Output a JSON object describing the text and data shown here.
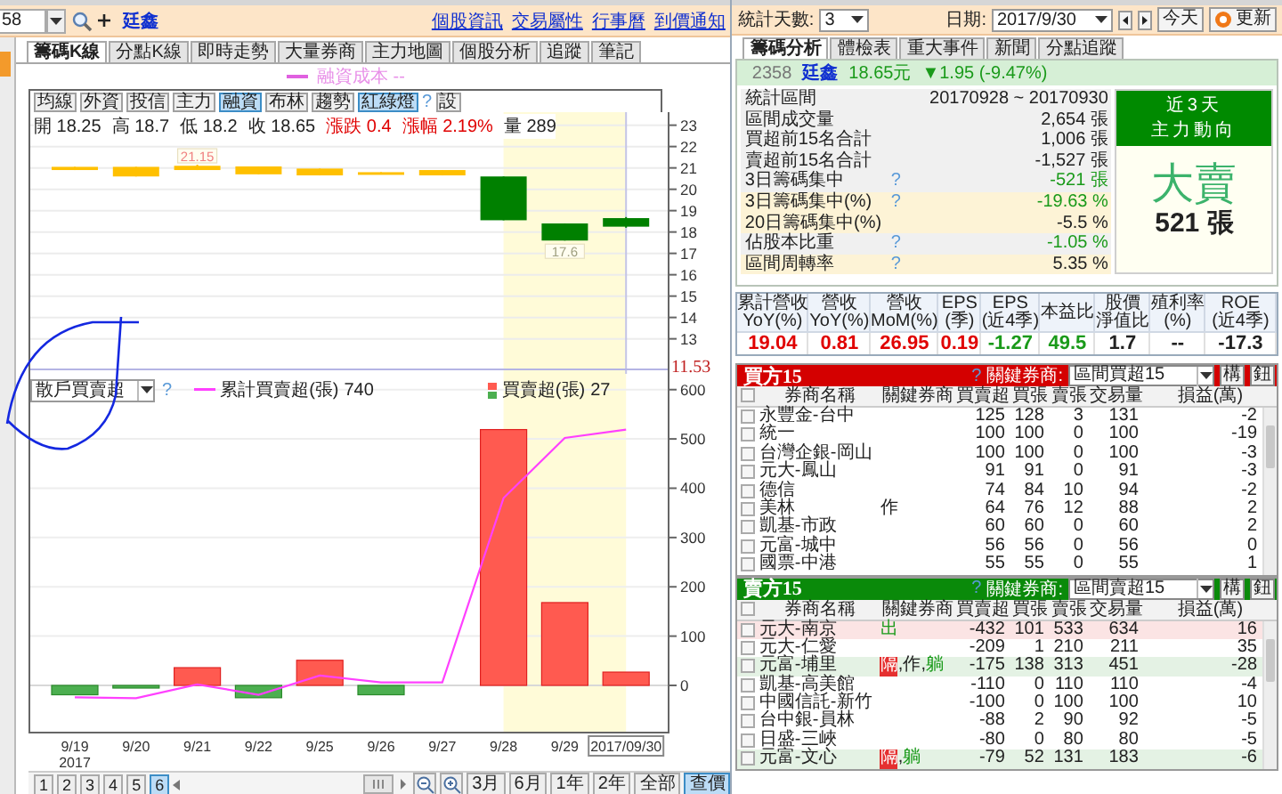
{
  "left": {
    "stock_field": {
      "value": "58"
    },
    "stock_name": "廷鑫",
    "links": [
      "個股資訊",
      "交易屬性",
      "行事曆",
      "到價通知"
    ],
    "tabs": [
      {
        "label": "籌碼K線",
        "selected": true
      },
      {
        "label": "分點K線",
        "selected": false
      },
      {
        "label": "即時走勢",
        "selected": false
      },
      {
        "label": "大量券商",
        "selected": false
      },
      {
        "label": "主力地圖",
        "selected": false
      },
      {
        "label": "個股分析",
        "selected": false
      },
      {
        "label": "追蹤",
        "selected": false
      },
      {
        "label": "筆記",
        "selected": false
      }
    ],
    "legend": {
      "label": "融資成本 --"
    },
    "toolbar": [
      {
        "label": "均線",
        "kind": "toggle",
        "selected": false
      },
      {
        "label": "外資",
        "kind": "toggle",
        "selected": false
      },
      {
        "label": "投信",
        "kind": "toggle",
        "selected": false
      },
      {
        "label": "主力",
        "kind": "toggle",
        "selected": false
      },
      {
        "label": "融資",
        "kind": "toggle",
        "selected": true
      },
      {
        "label": "布林",
        "kind": "toggle",
        "selected": false
      },
      {
        "label": "趨勢",
        "kind": "toggle",
        "selected": false
      },
      {
        "label": "紅綠燈",
        "kind": "toggle",
        "selected": true
      },
      {
        "label": "?",
        "kind": "help"
      },
      {
        "label": "設",
        "kind": "button"
      }
    ],
    "ohlc": [
      {
        "text": "開 18.25",
        "color": "#222222"
      },
      {
        "text": "高 18.7",
        "color": "#222222"
      },
      {
        "text": "低 18.2",
        "color": "#222222"
      },
      {
        "text": "收 18.65",
        "color": "#222222"
      },
      {
        "text": "漲跌 0.4",
        "color": "#e00000"
      },
      {
        "text": "漲幅 2.19%",
        "color": "#e00000"
      },
      {
        "text": "量 289",
        "color": "#222222"
      }
    ],
    "price_chart": {
      "chart_data": {
        "type": "candlestick",
        "grid": true,
        "series": [
          {
            "color": "#ffc000",
            "ohlc": [
              [
                20.9,
                21.05,
                20.9,
                21.05
              ],
              [
                20.6,
                21.05,
                20.6,
                21.05
              ],
              [
                20.9,
                21.15,
                20.9,
                21.1
              ],
              [
                20.7,
                21.07,
                20.7,
                21.07
              ],
              [
                20.65,
                20.97,
                20.65,
                20.97
              ],
              [
                20.72,
                20.8,
                20.72,
                20.8
              ],
              [
                20.65,
                20.9,
                20.65,
                20.9
              ],
              null,
              null,
              null
            ]
          },
          {
            "color": "#008000",
            "ohlc": [
              null,
              null,
              null,
              null,
              null,
              null,
              null,
              [
                20.6,
                20.6,
                18.55,
                18.55
              ],
              [
                18.4,
                18.4,
                17.6,
                17.6
              ],
              [
                18.65,
                18.7,
                18.2,
                18.25
              ]
            ]
          }
        ],
        "ylim": [
          11.36,
          23.61
        ],
        "yticks": [
          13,
          14,
          15,
          16,
          17,
          18,
          19,
          20,
          21,
          22,
          23
        ],
        "annotations": [
          "21.15",
          "17.6"
        ],
        "ref_lines": [
          {
            "label": "11.53"
          }
        ]
      }
    },
    "flow_chart": {
      "selector": {
        "value": "散戶買賣超"
      },
      "help": "?",
      "legend_values": [
        "740",
        "27"
      ],
      "year_label": "2017",
      "chart_data": {
        "type": "bar",
        "grid": true,
        "legend": "top",
        "categories": [
          "9/19",
          "9/20",
          "9/21",
          "9/22",
          "9/25",
          "9/26",
          "9/27",
          "9/28",
          "9/29",
          "2017/09/30"
        ],
        "series": [
          {
            "name": "累計買賣超(張)",
            "type": "line",
            "color": "#ff40ff",
            "values": [
              -24,
              -26,
              2,
              -19,
              20,
              6,
              6,
              380,
              502,
              519
            ]
          },
          {
            "name": "買賣超(張)",
            "type": "bar",
            "color": "#ff5a50",
            "values": [
              null,
              null,
              36,
              null,
              51,
              null,
              null,
              519,
              168,
              27
            ]
          },
          {
            "type": "bar",
            "color": "#4caf50",
            "values": [
              -19,
              -3,
              null,
              -25,
              null,
              -19,
              null,
              null,
              null,
              null
            ]
          }
        ],
        "ylim": [
          -97.5,
          632
        ],
        "yticks": [
          0,
          100,
          200,
          300,
          400,
          500,
          600
        ]
      }
    },
    "pages": [
      {
        "label": "1",
        "selected": false
      },
      {
        "label": "2",
        "selected": false
      },
      {
        "label": "3",
        "selected": false
      },
      {
        "label": "4",
        "selected": false
      },
      {
        "label": "5",
        "selected": false
      },
      {
        "label": "6",
        "selected": true
      }
    ],
    "ranges": [
      {
        "label": "3月",
        "selected": false
      },
      {
        "label": "6月",
        "selected": false
      },
      {
        "label": "1年",
        "selected": false
      },
      {
        "label": "2年",
        "selected": false
      },
      {
        "label": "全部",
        "selected": false
      },
      {
        "label": "查價",
        "selected": true
      }
    ]
  },
  "right": {
    "days": {
      "label": "統計天數:",
      "value": "3"
    },
    "date": {
      "label": "日期:",
      "value": "2017/9/30"
    },
    "today_button": "今天",
    "refresh_button": "更新",
    "tabs": [
      {
        "label": "籌碼分析",
        "selected": true
      },
      {
        "label": "體檢表",
        "selected": false
      },
      {
        "label": "重大事件",
        "selected": false
      },
      {
        "label": "新聞",
        "selected": false
      },
      {
        "label": "分點追蹤",
        "selected": false
      }
    ],
    "quote": {
      "code": "2358",
      "name": "廷鑫",
      "price": "18.65元",
      "change": "▼1.95 (-9.47%)"
    },
    "stats": [
      {
        "label": "統計區間",
        "value": "20170928 ~ 20170930",
        "color": "#222222",
        "highlighted": false
      },
      {
        "label": "區間成交量",
        "value": "2,654 張",
        "color": "#222222",
        "highlighted": false
      },
      {
        "label": "買超前15名合計",
        "value": "1,006 張",
        "color": "#222222",
        "highlighted": false
      },
      {
        "label": "賣超前15名合計",
        "value": "-1,527 張",
        "color": "#222222",
        "highlighted": false
      },
      {
        "label": "3日籌碼集中",
        "help": "?",
        "value": "-521 張",
        "color": "#1a9a1a",
        "highlighted": false
      },
      {
        "label": "3日籌碼集中(%)",
        "help": "?",
        "value": "-19.63 %",
        "color": "#1a9a1a",
        "highlighted": true
      },
      {
        "label": "20日籌碼集中(%)",
        "value": "-5.5 %",
        "color": "#222222",
        "highlighted": true
      },
      {
        "label": "佔股本比重",
        "help": "?",
        "value": "-1.05 %",
        "color": "#1a9a1a",
        "highlighted": false
      },
      {
        "label": "區間周轉率",
        "help": "?",
        "value": "5.35 %",
        "color": "#222222",
        "highlighted": true
      }
    ],
    "trend": {
      "title": [
        "近3天",
        "主力動向"
      ],
      "verdict": "大賣",
      "amount": "521 張"
    },
    "metrics": [
      {
        "header": [
          "累計營收",
          "YoY(%)"
        ],
        "value": "19.04",
        "color": "#e00000"
      },
      {
        "header": [
          "營收",
          "YoY(%)"
        ],
        "value": "0.81",
        "color": "#e00000"
      },
      {
        "header": [
          "營收",
          "MoM(%)"
        ],
        "value": "26.95",
        "color": "#e00000"
      },
      {
        "header": [
          "EPS",
          "(季)"
        ],
        "value": "0.19",
        "color": "#e00000"
      },
      {
        "header": [
          "EPS",
          "(近4季)"
        ],
        "value": "-1.27",
        "color": "#1a9a1a"
      },
      {
        "header": [
          "本益比"
        ],
        "value": "49.5",
        "color": "#1a9a1a"
      },
      {
        "header": [
          "股價",
          "淨值比"
        ],
        "value": "1.7",
        "color": "#222222"
      },
      {
        "header": [
          "殖利率",
          "(%)"
        ],
        "value": "--",
        "color": "#222222"
      },
      {
        "header": [
          "ROE",
          "(近4季)"
        ],
        "value": "-17.3",
        "color": "#222222"
      }
    ],
    "tables": [
      {
        "kind": "buy",
        "title": "買方15",
        "help": "?",
        "key_label": "關鍵券商:",
        "selector": "區間買超15",
        "buttons": [
          "構",
          "鈕"
        ],
        "all_checked": false,
        "columns": [
          "券商名稱",
          "關鍵券商",
          "買賣超",
          "買張",
          "賣張",
          "交易量",
          "損益(萬)"
        ],
        "rows": [
          {
            "checked": false,
            "broker": "永豐金-台中",
            "tags": [],
            "values": [
              "125",
              "128",
              "3",
              "131",
              "-2"
            ]
          },
          {
            "checked": false,
            "broker": "統一",
            "tags": [],
            "values": [
              "100",
              "100",
              "0",
              "100",
              "-19"
            ]
          },
          {
            "checked": false,
            "broker": "台灣企銀-岡山",
            "tags": [],
            "values": [
              "100",
              "100",
              "0",
              "100",
              "-3"
            ]
          },
          {
            "checked": false,
            "broker": "元大-鳳山",
            "tags": [],
            "values": [
              "91",
              "91",
              "0",
              "91",
              "-3"
            ]
          },
          {
            "checked": false,
            "broker": "德信",
            "tags": [],
            "values": [
              "74",
              "84",
              "10",
              "94",
              "-2"
            ]
          },
          {
            "checked": false,
            "broker": "美林",
            "tags": [
              {
                "text": "作",
                "kind": "plain"
              }
            ],
            "values": [
              "64",
              "76",
              "12",
              "88",
              "2"
            ]
          },
          {
            "checked": false,
            "broker": "凱基-市政",
            "tags": [],
            "values": [
              "60",
              "60",
              "0",
              "60",
              "2"
            ]
          },
          {
            "checked": false,
            "broker": "元富-城中",
            "tags": [],
            "values": [
              "56",
              "56",
              "0",
              "56",
              "0"
            ]
          },
          {
            "checked": false,
            "broker": "國票-中港",
            "tags": [],
            "values": [
              "55",
              "55",
              "0",
              "55",
              "1"
            ]
          }
        ]
      },
      {
        "kind": "sell",
        "title": "賣方15",
        "help": "?",
        "key_label": "關鍵券商:",
        "selector": "區間賣超15",
        "buttons": [
          "構",
          "鈕"
        ],
        "all_checked": false,
        "columns": [
          "券商名稱",
          "關鍵券商",
          "買賣超",
          "買張",
          "賣張",
          "交易量",
          "損益(萬)"
        ],
        "rows": [
          {
            "checked": false,
            "color": "#fbe4e4",
            "broker": "元大-南京",
            "tags": [
              {
                "text": "出",
                "kind": "green"
              }
            ],
            "values": [
              "-432",
              "101",
              "533",
              "634",
              "16"
            ]
          },
          {
            "checked": false,
            "broker": "元大-仁愛",
            "tags": [],
            "values": [
              "-209",
              "1",
              "210",
              "211",
              "35"
            ]
          },
          {
            "checked": false,
            "color": "#e4f2e4",
            "broker": "元富-埔里",
            "tags": [
              {
                "text": "隔",
                "kind": "filled"
              },
              {
                "text": ",",
                "kind": "plain"
              },
              {
                "text": "作",
                "kind": "plain"
              },
              {
                "text": ",",
                "kind": "plain"
              },
              {
                "text": "躺",
                "kind": "green"
              }
            ],
            "values": [
              "-175",
              "138",
              "313",
              "451",
              "-28"
            ]
          },
          {
            "checked": false,
            "broker": "凱基-高美館",
            "tags": [],
            "values": [
              "-110",
              "0",
              "110",
              "110",
              "-4"
            ]
          },
          {
            "checked": false,
            "broker": "中國信託-新竹",
            "tags": [],
            "values": [
              "-100",
              "0",
              "100",
              "100",
              "10"
            ]
          },
          {
            "checked": false,
            "broker": "台中銀-員林",
            "tags": [],
            "values": [
              "-88",
              "2",
              "90",
              "92",
              "-5"
            ]
          },
          {
            "checked": false,
            "broker": "日盛-三峽",
            "tags": [],
            "values": [
              "-80",
              "0",
              "80",
              "80",
              "-5"
            ]
          },
          {
            "checked": false,
            "color": "#e4f2e4",
            "broker": "元富-文心",
            "tags": [
              {
                "text": "隔",
                "kind": "filled"
              },
              {
                "text": ",",
                "kind": "plain"
              },
              {
                "text": "躺",
                "kind": "green"
              }
            ],
            "values": [
              "-79",
              "52",
              "131",
              "183",
              "-6"
            ]
          }
        ]
      }
    ]
  }
}
